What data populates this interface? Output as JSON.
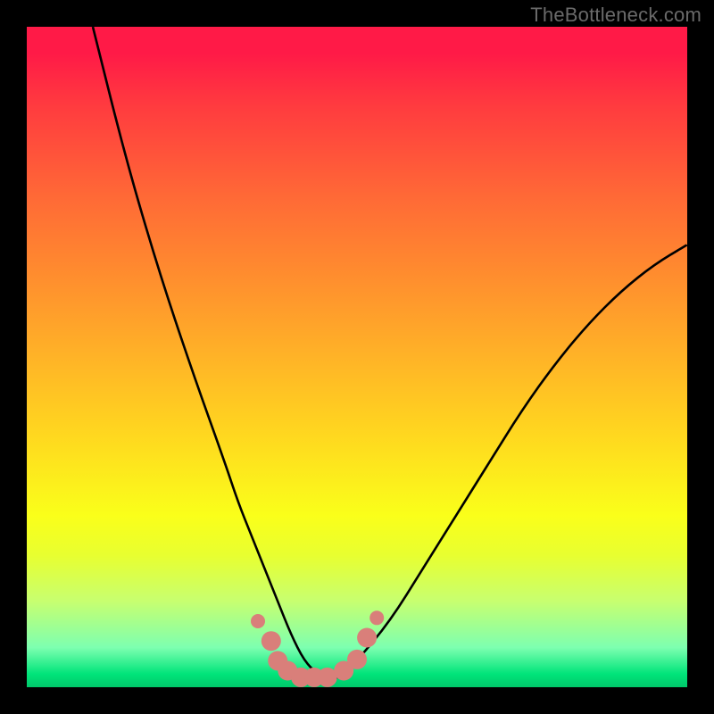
{
  "watermark": "TheBottleneck.com",
  "chart_data": {
    "type": "line",
    "title": "",
    "xlabel": "",
    "ylabel": "",
    "xlim": [
      0,
      100
    ],
    "ylim": [
      0,
      100
    ],
    "series": [
      {
        "name": "bottleneck-curve",
        "color": "#000000",
        "x": [
          10,
          15,
          20,
          25,
          30,
          32,
          34,
          36,
          38,
          40,
          42,
          44,
          46,
          48,
          50,
          55,
          60,
          65,
          70,
          75,
          80,
          85,
          90,
          95,
          100
        ],
        "y": [
          100,
          80,
          63,
          48,
          34,
          28,
          23,
          18,
          13,
          8,
          4,
          2,
          1,
          2,
          4,
          10,
          18,
          26,
          34,
          42,
          49,
          55,
          60,
          64,
          67
        ]
      }
    ],
    "markers": {
      "name": "bottom-band",
      "color": "#d97f7a",
      "x": [
        35.0,
        37.0,
        38.0,
        39.5,
        41.5,
        43.5,
        45.5,
        48.0,
        50.0,
        51.5,
        53.0
      ],
      "y": [
        10.0,
        7.0,
        4.0,
        2.5,
        1.5,
        1.5,
        1.5,
        2.5,
        4.2,
        7.5,
        10.5
      ]
    },
    "gradient_stops": [
      {
        "pos": 0,
        "color": "#ff1a47"
      },
      {
        "pos": 50,
        "color": "#ffd81f"
      },
      {
        "pos": 100,
        "color": "#00c86a"
      }
    ]
  }
}
